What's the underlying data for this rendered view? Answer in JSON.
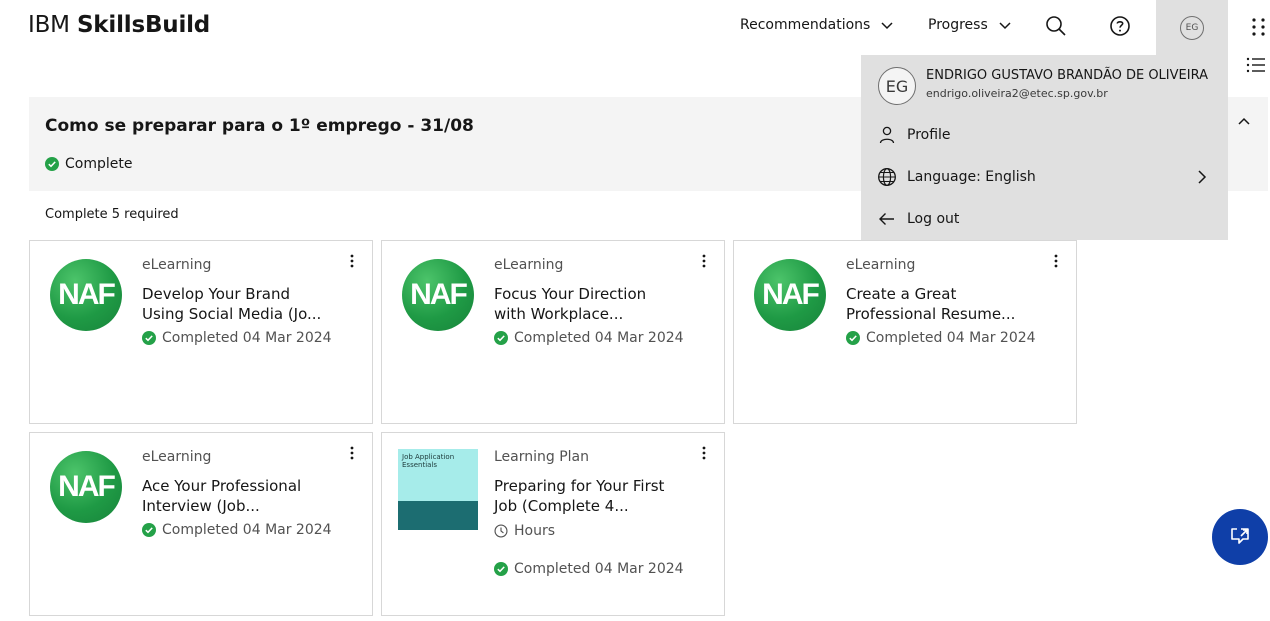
{
  "header": {
    "brand_regular": "IBM",
    "brand_bold": "SkillsBuild",
    "nav": [
      "Recommendations",
      "Progress"
    ],
    "avatar_initials": "EG"
  },
  "banner": {
    "title": "Como se preparar para o 1º emprego - 31/08",
    "status": "Complete"
  },
  "requirement_text": "Complete 5 required",
  "cards": [
    {
      "type": "eLearning",
      "title_line1": "Develop Your Brand",
      "title_line2": "Using Social Media (Jo...",
      "status": "Completed 04 Mar 2024",
      "thumb": "NAF"
    },
    {
      "type": "eLearning",
      "title_line1": "Focus Your Direction",
      "title_line2": "with Workplace...",
      "status": "Completed 04 Mar 2024",
      "thumb": "NAF"
    },
    {
      "type": "eLearning",
      "title_line1": "Create a Great",
      "title_line2": "Professional Resume...",
      "status": "Completed 04 Mar 2024",
      "thumb": "NAF"
    },
    {
      "type": "eLearning",
      "title_line1": "Ace Your Professional",
      "title_line2": "Interview (Job...",
      "status": "Completed 04 Mar 2024",
      "thumb": "NAF"
    },
    {
      "type": "Learning Plan",
      "title_line1": "Preparing for Your First",
      "title_line2": "Job (Complete 4...",
      "hours": "Hours",
      "status": "Completed 04 Mar 2024",
      "thumb_title": "Job Application Essentials"
    }
  ],
  "user_menu": {
    "initials": "EG",
    "name": "ENDRIGO GUSTAVO BRANDÃO DE OLIVEIRA",
    "email": "endrigo.oliveira2@etec.sp.gov.br",
    "items": [
      "Profile",
      "Language: English",
      "Log out"
    ]
  },
  "colors": {
    "success": "#24a148",
    "menu_bg": "#e0e0e0",
    "banner_bg": "#f4f4f4",
    "fab": "#0f3fa8"
  }
}
